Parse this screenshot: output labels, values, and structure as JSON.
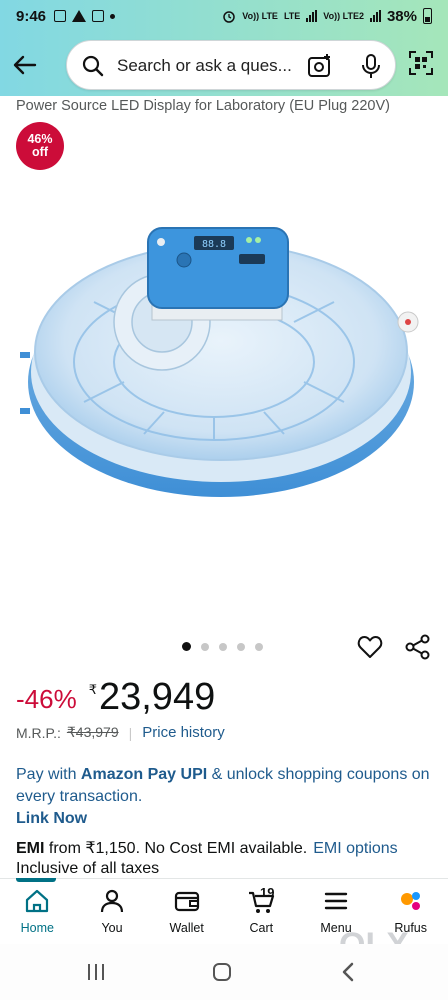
{
  "status_bar": {
    "time": "9:46",
    "network_labels": [
      "Vo)) LTE",
      "LTE",
      "Vo)) LTE2"
    ],
    "battery": "38%"
  },
  "search": {
    "placeholder": "Search or ask a ques..."
  },
  "product": {
    "title": "Power Source LED Display for Laboratory (EU Plug 220V)",
    "badge_line1": "46%",
    "badge_line2": "off",
    "carousel": {
      "count": 5,
      "active_index": 0
    }
  },
  "price": {
    "discount": "-46%",
    "currency_symbol": "₹",
    "value": "23,949",
    "mrp_label": "M.R.P.:",
    "mrp_value": "₹43,979",
    "price_history": "Price history"
  },
  "amazon_pay": {
    "prefix": "Pay with ",
    "brand": "Amazon Pay UPI",
    "suffix": " & unlock shopping coupons on every transaction.",
    "link": "Link Now"
  },
  "emi": {
    "label": "EMI",
    "text": " from ₹1,150. No Cost EMI available.",
    "link": "EMI options"
  },
  "taxes": "Inclusive of all taxes",
  "bottom_nav": {
    "items": [
      {
        "label": "Home",
        "icon": "home-icon",
        "active": true
      },
      {
        "label": "You",
        "icon": "user-icon"
      },
      {
        "label": "Wallet",
        "icon": "wallet-icon"
      },
      {
        "label": "Cart",
        "icon": "cart-icon",
        "count": "19"
      },
      {
        "label": "Menu",
        "icon": "menu-icon"
      },
      {
        "label": "Rufus",
        "icon": "rufus-icon"
      }
    ]
  },
  "colors": {
    "header_gradient_start": "#82d8e3",
    "header_gradient_end": "#a5e6ba",
    "discount_red": "#cc0c39",
    "link_blue": "#1f5b8d",
    "nav_active": "#007185"
  },
  "watermark": "OLX"
}
